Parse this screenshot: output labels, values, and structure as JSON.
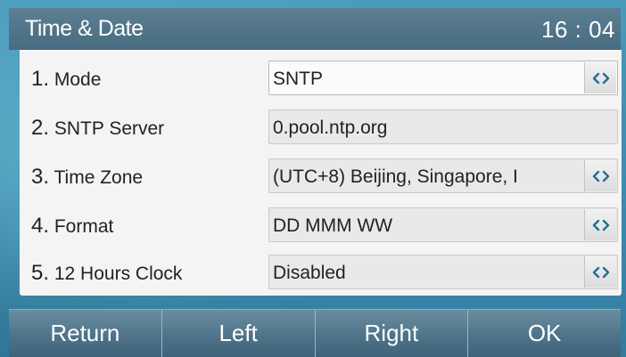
{
  "header": {
    "title": "Time & Date",
    "time": "16 : 04"
  },
  "settings": [
    {
      "number": "1.",
      "label": "Mode",
      "value": "SNTP",
      "has_switch": true,
      "active": true
    },
    {
      "number": "2.",
      "label": "SNTP Server",
      "value": "0.pool.ntp.org",
      "has_switch": false,
      "active": false
    },
    {
      "number": "3.",
      "label": "Time Zone",
      "value": "(UTC+8) Beijing, Singapore, I",
      "has_switch": true,
      "active": false
    },
    {
      "number": "4.",
      "label": "Format",
      "value": "DD MMM WW",
      "has_switch": true,
      "active": false
    },
    {
      "number": "5.",
      "label": "12 Hours Clock",
      "value": "Disabled",
      "has_switch": true,
      "active": false
    }
  ],
  "softkeys": {
    "return_label": "Return",
    "left_label": "Left",
    "right_label": "Right",
    "ok_label": "OK"
  },
  "icons": {
    "switch": "left-right-arrows-icon"
  },
  "colors": {
    "switch_arrow": "#1f6f93",
    "titlebar": "#4f7489",
    "panel": "#f4f4f4"
  }
}
